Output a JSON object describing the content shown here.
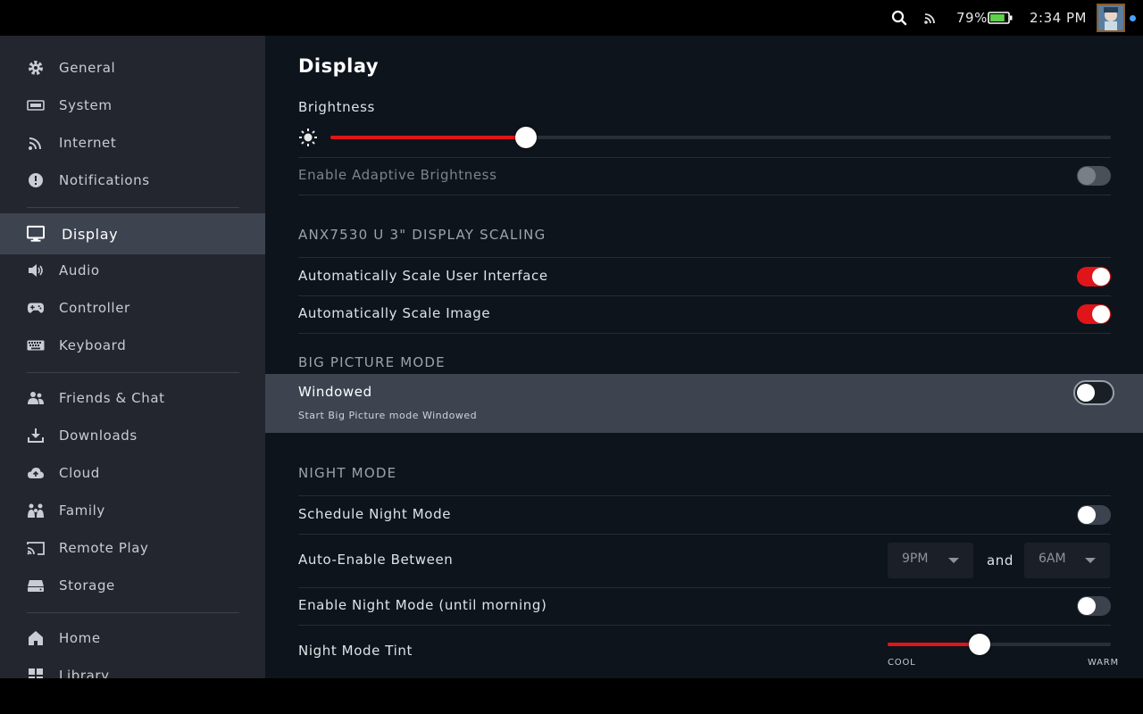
{
  "status_bar": {
    "battery_percent": "79%",
    "battery_level": 0.79,
    "time": "2:34 PM",
    "icons": [
      "search-icon",
      "wifi-signal-icon",
      "battery-icon",
      "avatar",
      "notification-dot"
    ],
    "notification_dot_color": "#4aa3ff"
  },
  "sidebar": {
    "items": [
      {
        "label": "General",
        "icon": "gear-icon"
      },
      {
        "label": "System",
        "icon": "system-icon"
      },
      {
        "label": "Internet",
        "icon": "wifi-icon"
      },
      {
        "label": "Notifications",
        "icon": "alert-icon"
      },
      {
        "label": "Display",
        "icon": "monitor-icon",
        "active": true
      },
      {
        "label": "Audio",
        "icon": "speaker-icon"
      },
      {
        "label": "Controller",
        "icon": "gamepad-icon"
      },
      {
        "label": "Keyboard",
        "icon": "keyboard-icon"
      },
      {
        "label": "Friends & Chat",
        "icon": "people-icon"
      },
      {
        "label": "Downloads",
        "icon": "download-icon"
      },
      {
        "label": "Cloud",
        "icon": "cloud-icon"
      },
      {
        "label": "Family",
        "icon": "family-icon"
      },
      {
        "label": "Remote Play",
        "icon": "cast-icon"
      },
      {
        "label": "Storage",
        "icon": "storage-icon"
      },
      {
        "label": "Home",
        "icon": "home-icon"
      },
      {
        "label": "Library",
        "icon": "library-icon"
      }
    ]
  },
  "main": {
    "title": "Display",
    "brightness": {
      "label": "Brightness",
      "value": 0.25
    },
    "adaptive_brightness": {
      "label": "Enable Adaptive Brightness",
      "enabled": false,
      "disabled": true
    },
    "scaling_section": "ANX7530 U 3\" DISPLAY SCALING",
    "scale_ui": {
      "label": "Automatically Scale User Interface",
      "on": true
    },
    "scale_image": {
      "label": "Automatically Scale Image",
      "on": true
    },
    "big_picture_section": "BIG PICTURE MODE",
    "windowed": {
      "label": "Windowed",
      "description": "Start Big Picture mode Windowed",
      "on": false
    },
    "night_section": "NIGHT MODE",
    "schedule_night": {
      "label": "Schedule Night Mode",
      "on": false
    },
    "auto_enable": {
      "label": "Auto-Enable Between",
      "from": "9PM",
      "and_label": "and",
      "to": "6AM"
    },
    "night_until_morning": {
      "label": "Enable Night Mode (until morning)",
      "on": false
    },
    "night_tint": {
      "label": "Night Mode Tint",
      "value": 0.41,
      "cool_label": "COOL",
      "warm_label": "WARM"
    }
  },
  "colors": {
    "accent": "#e0151a",
    "sidebar_bg": "#23262e",
    "main_bg": "#0e141b",
    "active_bg": "#3d4450"
  }
}
